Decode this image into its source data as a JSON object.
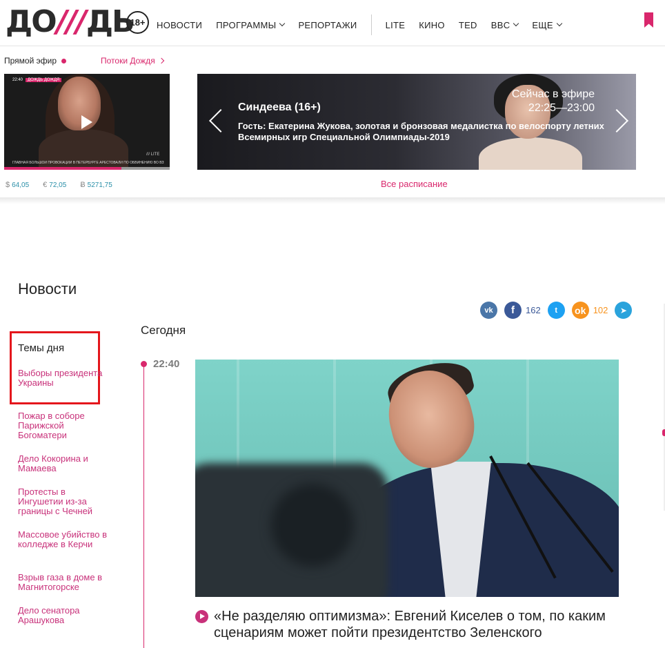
{
  "header": {
    "logo_left": "ДО",
    "logo_slashes": "///",
    "logo_right": "ДЬ",
    "age_rating": "18+",
    "nav": [
      {
        "label": "НОВОСТИ",
        "dropdown": false
      },
      {
        "label": "ПРОГРАММЫ",
        "dropdown": true
      },
      {
        "label": "РЕПОРТАЖИ",
        "dropdown": false
      }
    ],
    "nav_secondary": [
      {
        "label": "LITE",
        "dropdown": false
      },
      {
        "label": "КИНО",
        "dropdown": false
      },
      {
        "label": "TED",
        "dropdown": false
      },
      {
        "label": "BBC",
        "dropdown": true
      },
      {
        "label": "ЕЩЕ",
        "dropdown": true
      }
    ]
  },
  "live": {
    "label": "Прямой эфир",
    "streams_link": "Потоки Дождя",
    "player_time": "22:40",
    "player_tag": "ДОЖДЬ ДОЖДЯ",
    "player_ticker": "ГЛАВНАЯ БОЛЬШОЙ ПРОВОКАЦИИ В ПЕТЕРБУРГЕ АРЕСТОВАЛИ ПО ОБВИНЕНИЮ ВО ВЗЯТКЕ",
    "player_brand": "/// LITE",
    "progress": 0.71
  },
  "rates": [
    {
      "symbol": "$",
      "value": "64,05"
    },
    {
      "symbol": "€",
      "value": "72,05"
    },
    {
      "symbol": "Ƀ",
      "value": "5271,75"
    }
  ],
  "banner": {
    "show": "Синдеева (16+)",
    "guest": "Гость: Екатерина Жукова, золотая и бронзовая медалистка по велоспорту летних Всемирных игр Специальной Олимпиады-2019",
    "onair_label": "Сейчас в эфире",
    "onair_time": "22:25—23:00"
  },
  "schedule_link": "Все расписание",
  "news": {
    "title": "Новости",
    "share": {
      "vk": "vk",
      "fb": "f",
      "fb_count": "162",
      "tw": "t",
      "ok": "ok",
      "ok_count": "102",
      "tg": "➤"
    },
    "themes_title": "Темы дня",
    "themes": [
      "Выборы президента Украины",
      "Пожар в соборе Парижской Богоматери",
      "Дело Кокорина и Мамаева",
      "Протесты в Ингушетии из-за границы с Чечней",
      "Массовое убийство в колледже в Керчи",
      "Взрыв газа в доме в Магнитогорске",
      "Дело сенатора Арашукова"
    ],
    "today_label": "Сегодня",
    "items": [
      {
        "time": "22:40",
        "headline": "«Не разделяю оптимизма»: Евгений Киселев о том, по каким сценариям может пойти президентство Зеленского"
      }
    ]
  },
  "colors": {
    "accent": "#d9276c",
    "link": "#c8317a",
    "highlight_box": "#e4161c"
  }
}
